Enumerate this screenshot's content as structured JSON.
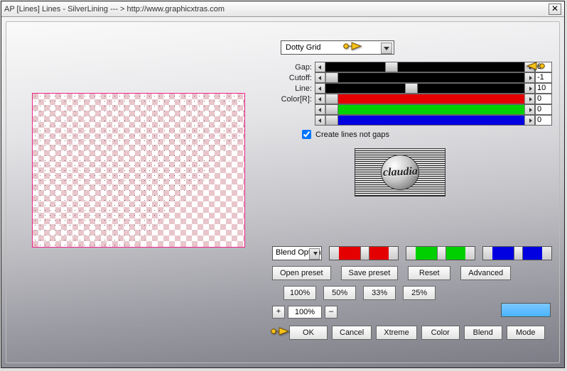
{
  "title": "AP [Lines]  Lines - SilverLining    --- >  http://www.graphicxtras.com",
  "combo_selected": "Dotty Grid",
  "sliders": [
    {
      "label": "Gap:",
      "value": "8",
      "fill": "#000000",
      "thumb_pct": 30
    },
    {
      "label": "Cutoff:",
      "value": "-1",
      "fill": "#000000",
      "thumb_pct": 0
    },
    {
      "label": "Line:",
      "value": "10",
      "fill": "#000000",
      "thumb_pct": 40
    },
    {
      "label": "Color[R]:",
      "value": "0",
      "fill": "#e40000",
      "thumb_pct": 0
    },
    {
      "label": "",
      "value": "0",
      "fill": "#00d000",
      "thumb_pct": 0
    },
    {
      "label": "",
      "value": "0",
      "fill": "#0000e0",
      "thumb_pct": 0
    }
  ],
  "checkbox": {
    "checked": true,
    "label": "Create lines not gaps"
  },
  "logo_text": "claudia",
  "blend_select": "Blend Options",
  "presets": {
    "open": "Open preset",
    "save": "Save preset",
    "reset": "Reset",
    "adv": "Advanced"
  },
  "pcts": [
    "100%",
    "50%",
    "33%",
    "25%"
  ],
  "zoom": {
    "plus": "+",
    "value": "100%",
    "minus": "–"
  },
  "bottom": [
    "OK",
    "Cancel",
    "Xtreme",
    "Color",
    "Blend",
    "Mode"
  ],
  "icons": {
    "close": "✕"
  }
}
